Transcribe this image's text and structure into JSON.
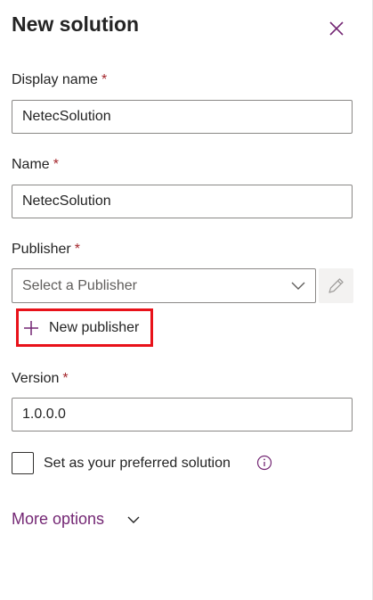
{
  "panel": {
    "title": "New solution",
    "close_icon": "close-icon"
  },
  "display_name": {
    "label": "Display name",
    "required_marker": "*",
    "value": "NetecSolution"
  },
  "name": {
    "label": "Name",
    "required_marker": "*",
    "value": "NetecSolution"
  },
  "publisher": {
    "label": "Publisher",
    "required_marker": "*",
    "placeholder": "Select a Publisher",
    "dropdown_icon": "chevron-down-icon",
    "edit_icon": "pencil-icon",
    "new_publisher_label": "New publisher",
    "new_publisher_icon": "plus-icon",
    "highlight_color": "#e8121a"
  },
  "version": {
    "label": "Version",
    "required_marker": "*",
    "value": "1.0.0.0"
  },
  "preferred": {
    "label": "Set as your preferred solution",
    "checked": false,
    "info_icon": "info-icon"
  },
  "more_options": {
    "label": "More options",
    "icon": "chevron-down-icon",
    "color": "#742774"
  },
  "colors": {
    "accent": "#742774",
    "required": "#a4262c"
  }
}
